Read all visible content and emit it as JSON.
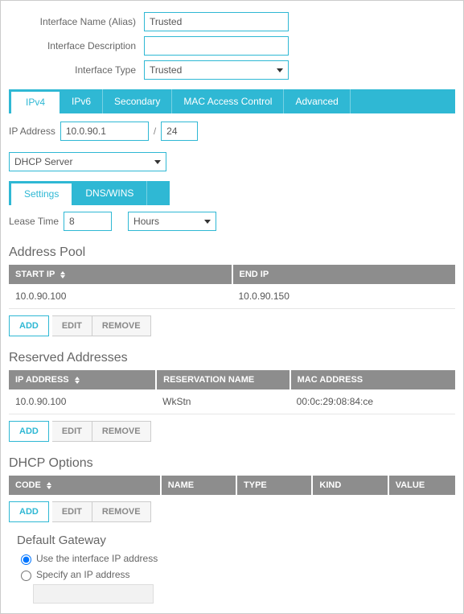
{
  "form": {
    "interface_name_label": "Interface Name (Alias)",
    "interface_name_value": "Trusted",
    "interface_desc_label": "Interface Description",
    "interface_desc_value": "",
    "interface_type_label": "Interface Type",
    "interface_type_value": "Trusted"
  },
  "main_tabs": {
    "ipv4": "IPv4",
    "ipv6": "IPv6",
    "secondary": "Secondary",
    "mac": "MAC Access Control",
    "advanced": "Advanced"
  },
  "ip_section": {
    "ip_address_label": "IP Address",
    "ip_value": "10.0.90.1",
    "mask_value": "24",
    "dhcp_mode": "DHCP Server"
  },
  "sub_tabs": {
    "settings": "Settings",
    "dnswins": "DNS/WINS"
  },
  "lease": {
    "label": "Lease Time",
    "value": "8",
    "unit": "Hours"
  },
  "address_pool": {
    "title": "Address Pool",
    "cols": {
      "start": "START IP",
      "end": "END IP"
    },
    "rows": [
      {
        "start": "10.0.90.100",
        "end": "10.0.90.150"
      }
    ]
  },
  "reserved": {
    "title": "Reserved Addresses",
    "cols": {
      "ip": "IP ADDRESS",
      "name": "RESERVATION NAME",
      "mac": "MAC ADDRESS"
    },
    "rows": [
      {
        "ip": "10.0.90.100",
        "name": "WkStn",
        "mac": "00:0c:29:08:84:ce"
      }
    ]
  },
  "dhcp_options": {
    "title": "DHCP Options",
    "cols": {
      "code": "CODE",
      "name": "NAME",
      "type": "TYPE",
      "kind": "KIND",
      "value": "VALUE"
    }
  },
  "buttons": {
    "add": "ADD",
    "edit": "EDIT",
    "remove": "REMOVE"
  },
  "gateway": {
    "title": "Default Gateway",
    "use_iface": "Use the interface IP address",
    "specify": "Specify an IP address",
    "value": ""
  }
}
